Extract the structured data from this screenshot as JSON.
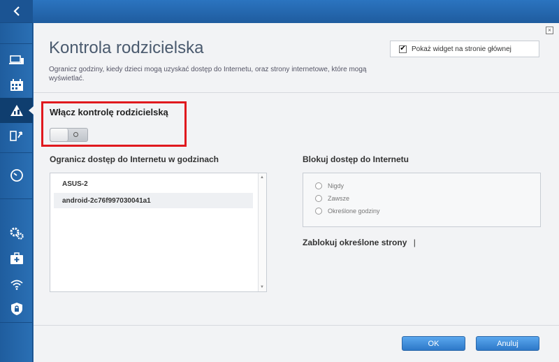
{
  "nav": {
    "back_label": "<",
    "items": [
      {
        "icon": "devices-icon"
      },
      {
        "icon": "calendar-icon"
      },
      {
        "icon": "parental-control-icon",
        "active": true
      },
      {
        "icon": "priority-icon"
      },
      {
        "icon": "speedtest-icon"
      },
      {
        "icon": "settings-icon"
      },
      {
        "icon": "first-aid-icon"
      },
      {
        "icon": "wifi-icon"
      },
      {
        "icon": "security-icon"
      }
    ]
  },
  "dialog": {
    "close_label": "×",
    "title": "Kontrola rodzicielska",
    "description": "Ogranicz godziny, kiedy dzieci mogą uzyskać dostęp do Internetu, oraz strony internetowe, które mogą wyświetlać.",
    "widget_checkbox": {
      "label": "Pokaż widget na stronie głównej",
      "checked": true,
      "mark": "✔"
    },
    "enable": {
      "label": "Włącz kontrolę rodzicielską",
      "state": "off"
    },
    "restrict_section": {
      "heading": "Ogranicz dostęp do Internetu w godzinach",
      "devices": [
        "ASUS-2",
        "android-2c76f997030041a1"
      ]
    },
    "block_section": {
      "heading": "Blokuj dostęp do Internetu",
      "options": [
        "Nigdy",
        "Zawsze",
        "Określone godziny"
      ]
    },
    "block_sites": {
      "heading": "Zablokuj określone strony",
      "cursor": "|"
    },
    "buttons": {
      "ok": "OK",
      "cancel": "Anuluj"
    }
  },
  "colors": {
    "accent": "#2d78c8",
    "highlight_border": "#e0191e",
    "sidebar": "#1f5d9e"
  }
}
